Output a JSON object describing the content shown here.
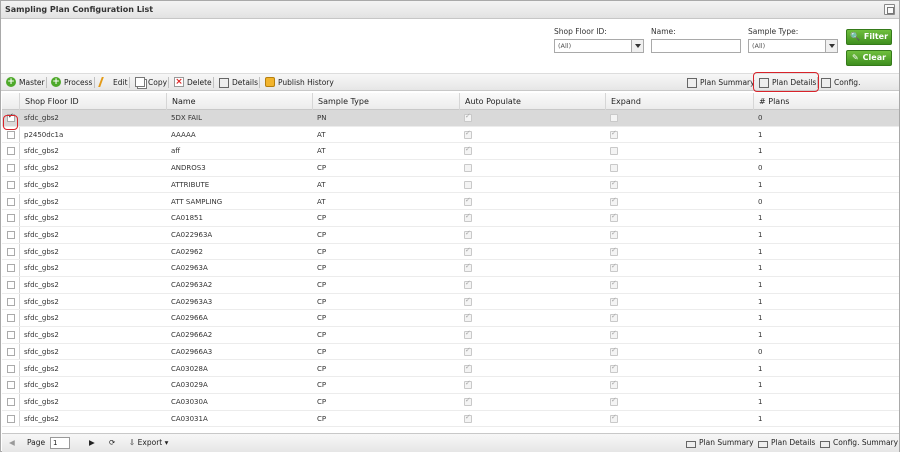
{
  "window": {
    "title": "Sampling Plan Configuration List"
  },
  "filters": {
    "shop_floor": {
      "label": "Shop Floor ID:",
      "value": "(All)"
    },
    "name": {
      "label": "Name:",
      "value": ""
    },
    "sample_type": {
      "label": "Sample Type:",
      "value": "(All)"
    },
    "filter_label": "Filter",
    "clear_label": "Clear"
  },
  "toolbar": {
    "master": "Master",
    "process": "Process",
    "edit": "Edit",
    "copy": "Copy",
    "delete": "Delete",
    "details": "Details",
    "publish_history": "Publish History",
    "plan_summary": "Plan Summary",
    "plan_details": "Plan Details",
    "config_summary": "Config. Summary"
  },
  "table": {
    "columns": [
      "Shop Floor ID",
      "Name",
      "Sample Type",
      "Auto Populate",
      "Expand",
      "# Plans"
    ],
    "rows": [
      {
        "shop": "sfdc_gbs2",
        "name": "5DX FAIL",
        "type": "PN",
        "auto": true,
        "expand": false,
        "plans": "0",
        "selected": true
      },
      {
        "shop": "p2450dc1a",
        "name": "AAAAA",
        "type": "AT",
        "auto": true,
        "expand": true,
        "plans": "1"
      },
      {
        "shop": "sfdc_gbs2",
        "name": "aff",
        "type": "AT",
        "auto": true,
        "expand": false,
        "plans": "1"
      },
      {
        "shop": "sfdc_gbs2",
        "name": "ANDROS3",
        "type": "CP",
        "auto": false,
        "expand": false,
        "plans": "0"
      },
      {
        "shop": "sfdc_gbs2",
        "name": "ATTRIBUTE",
        "type": "AT",
        "auto": false,
        "expand": true,
        "plans": "1"
      },
      {
        "shop": "sfdc_gbs2",
        "name": "ATT SAMPLING",
        "type": "AT",
        "auto": true,
        "expand": true,
        "plans": "0"
      },
      {
        "shop": "sfdc_gbs2",
        "name": "CA01851",
        "type": "CP",
        "auto": true,
        "expand": true,
        "plans": "1"
      },
      {
        "shop": "sfdc_gbs2",
        "name": "CA022963A",
        "type": "CP",
        "auto": true,
        "expand": true,
        "plans": "1"
      },
      {
        "shop": "sfdc_gbs2",
        "name": "CA02962",
        "type": "CP",
        "auto": true,
        "expand": true,
        "plans": "1"
      },
      {
        "shop": "sfdc_gbs2",
        "name": "CA02963A",
        "type": "CP",
        "auto": true,
        "expand": true,
        "plans": "1"
      },
      {
        "shop": "sfdc_gbs2",
        "name": "CA02963A2",
        "type": "CP",
        "auto": true,
        "expand": true,
        "plans": "1"
      },
      {
        "shop": "sfdc_gbs2",
        "name": "CA02963A3",
        "type": "CP",
        "auto": true,
        "expand": true,
        "plans": "1"
      },
      {
        "shop": "sfdc_gbs2",
        "name": "CA02966A",
        "type": "CP",
        "auto": true,
        "expand": true,
        "plans": "1"
      },
      {
        "shop": "sfdc_gbs2",
        "name": "CA02966A2",
        "type": "CP",
        "auto": true,
        "expand": true,
        "plans": "1"
      },
      {
        "shop": "sfdc_gbs2",
        "name": "CA02966A3",
        "type": "CP",
        "auto": true,
        "expand": true,
        "plans": "0"
      },
      {
        "shop": "sfdc_gbs2",
        "name": "CA03028A",
        "type": "CP",
        "auto": true,
        "expand": true,
        "plans": "1"
      },
      {
        "shop": "sfdc_gbs2",
        "name": "CA03029A",
        "type": "CP",
        "auto": true,
        "expand": true,
        "plans": "1"
      },
      {
        "shop": "sfdc_gbs2",
        "name": "CA03030A",
        "type": "CP",
        "auto": true,
        "expand": true,
        "plans": "1"
      },
      {
        "shop": "sfdc_gbs2",
        "name": "CA03031A",
        "type": "CP",
        "auto": true,
        "expand": true,
        "plans": "1"
      }
    ]
  },
  "footer": {
    "page_label": "Page",
    "page_value": "1",
    "export_label": "Export",
    "plan_summary": "Plan Summary",
    "plan_details": "Plan Details",
    "config_summary": "Config. Summary"
  },
  "colors": {
    "highlight": "#d8232a",
    "filter_green": "#4ea92a",
    "selected_row": "#d9d9d9"
  }
}
